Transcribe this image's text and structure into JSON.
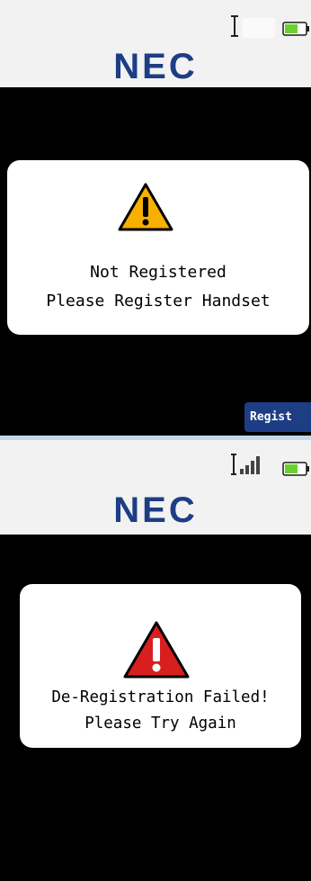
{
  "screens": [
    {
      "brand": "NEC",
      "signal_icon": "signal-none-icon",
      "battery_icon": "battery-low-icon",
      "alert": {
        "icon": "warning-icon",
        "icon_color": "#f7b000",
        "line1": "Not Registered",
        "line2": "Please Register Handset"
      },
      "softkey_label": "Regist"
    },
    {
      "brand": "NEC",
      "signal_icon": "signal-strength-icon",
      "battery_icon": "battery-low-icon",
      "alert": {
        "icon": "error-icon",
        "icon_color": "#d81f1f",
        "line1": "De-Registration Failed!",
        "line2": "Please Try Again"
      }
    }
  ],
  "colors": {
    "brand": "#1d3d85",
    "softkey_bg": "#1d3d85",
    "divider": "#c4d6e8"
  }
}
